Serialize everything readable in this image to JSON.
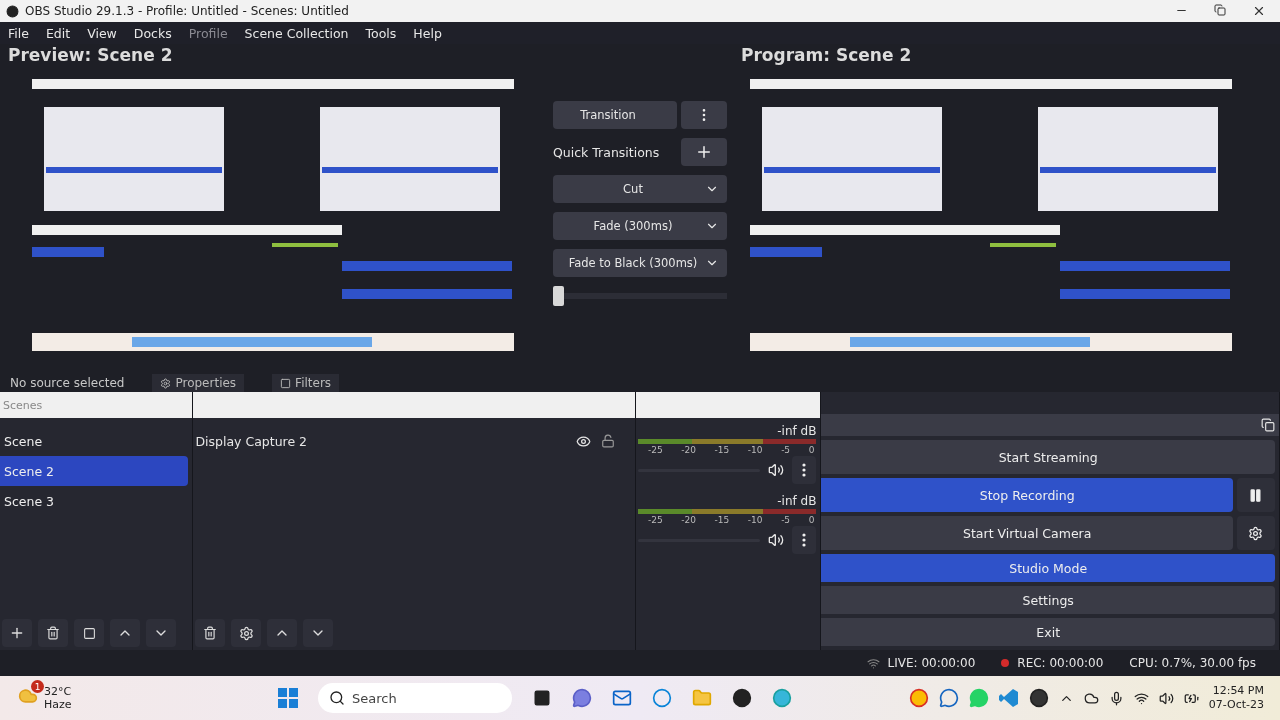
{
  "window": {
    "title": "OBS Studio 29.1.3 - Profile: Untitled - Scenes: Untitled"
  },
  "menu": [
    {
      "label": "File",
      "disabled": false
    },
    {
      "label": "Edit",
      "disabled": false
    },
    {
      "label": "View",
      "disabled": false
    },
    {
      "label": "Docks",
      "disabled": false
    },
    {
      "label": "Profile",
      "disabled": true
    },
    {
      "label": "Scene Collection",
      "disabled": false
    },
    {
      "label": "Tools",
      "disabled": false
    },
    {
      "label": "Help",
      "disabled": false
    }
  ],
  "preview": {
    "title": "Preview: Scene 2"
  },
  "program": {
    "title": "Program: Scene 2"
  },
  "transitions": {
    "transition_button": "Transition",
    "quick_label": "Quick Transitions",
    "quick": [
      {
        "label": "Cut"
      },
      {
        "label": "Fade (300ms)"
      },
      {
        "label": "Fade to Black (300ms)"
      }
    ],
    "tbar": {
      "level": 0
    }
  },
  "context_bar": {
    "text": "No source selected",
    "buttons": [
      "Properties",
      "Filters"
    ]
  },
  "scenes": {
    "title": "Scenes",
    "items": [
      {
        "name": "Scene",
        "selected": false
      },
      {
        "name": "Scene 2",
        "selected": true
      },
      {
        "name": "Scene 3",
        "selected": false
      }
    ]
  },
  "sources": {
    "items": [
      {
        "name": "Display Capture 2",
        "visible": true,
        "locked": false
      }
    ]
  },
  "mixer": {
    "channels": [
      {
        "reading": "-inf dB",
        "scale": [
          "-25",
          "-20",
          "-15",
          "-10",
          "-5",
          "0"
        ],
        "muted": false
      },
      {
        "reading": "-inf dB",
        "scale": [
          "-25",
          "-20",
          "-15",
          "-10",
          "-5",
          "0"
        ],
        "muted": false
      }
    ]
  },
  "controls": {
    "buttons": [
      {
        "label": "Start Streaming",
        "active": false,
        "kind": "plain"
      },
      {
        "label": "Stop Recording",
        "active": true,
        "kind": "pause"
      },
      {
        "label": "Start Virtual Camera",
        "active": false,
        "kind": "gear"
      },
      {
        "label": "Studio Mode",
        "active": true,
        "kind": "plain"
      },
      {
        "label": "Settings",
        "active": false,
        "kind": "plain"
      },
      {
        "label": "Exit",
        "active": false,
        "kind": "plain"
      }
    ]
  },
  "status_bar": {
    "live": "LIVE: 00:00:00",
    "rec": "REC: 00:00:00",
    "cpu": "CPU: 0.7%, 30.00 fps"
  },
  "taskbar": {
    "weather": {
      "temp": "32°C",
      "condition": "Haze",
      "badge": "1"
    },
    "search": {
      "placeholder": "Search"
    },
    "time": "12:54 PM",
    "date": "07-Oct-23"
  }
}
